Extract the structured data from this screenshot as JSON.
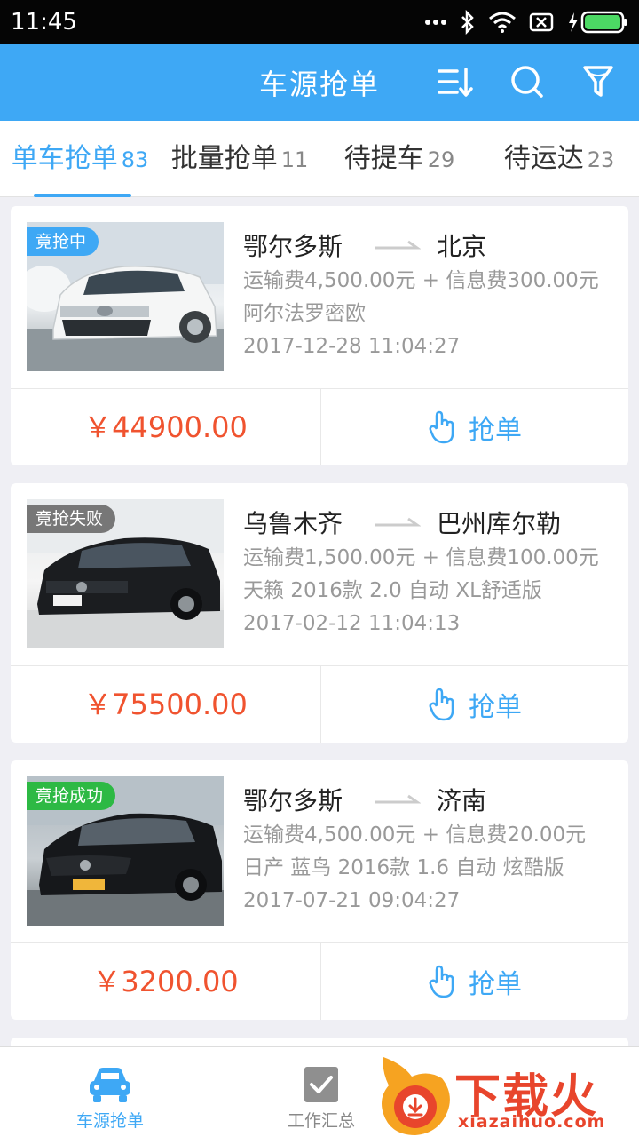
{
  "status_bar": {
    "time": "11:45"
  },
  "nav": {
    "title": "车源抢单"
  },
  "tabs": [
    {
      "label": "单车抢单",
      "count": "83"
    },
    {
      "label": "批量抢单",
      "count": "11"
    },
    {
      "label": "待提车",
      "count": "29"
    },
    {
      "label": "待运达",
      "count": "23"
    }
  ],
  "orders": [
    {
      "badge": "竟抢中",
      "from": "鄂尔多斯",
      "to": "北京",
      "fees": "运输费4,500.00元 + 信息费300.00元",
      "model": "阿尔法罗密欧",
      "date": "2017-12-28 11:04:27",
      "price": "￥44900.00",
      "action": "抢单"
    },
    {
      "badge": "竟抢失败",
      "from": "乌鲁木齐",
      "to": "巴州库尔勒",
      "fees": "运输费1,500.00元 + 信息费100.00元",
      "model": "天籁 2016款 2.0 自动 XL舒适版",
      "date": "2017-02-12 11:04:13",
      "price": "￥75500.00",
      "action": "抢单"
    },
    {
      "badge": "竟抢成功",
      "from": "鄂尔多斯",
      "to": "济南",
      "fees": "运输费4,500.00元 + 信息费20.00元",
      "model": "日产 蓝鸟 2016款 1.6 自动 炫酷版",
      "date": "2017-07-21 09:04:27",
      "price": "￥3200.00",
      "action": "抢单"
    }
  ],
  "tabbar": [
    {
      "label": "车源抢单"
    },
    {
      "label": "工作汇总"
    }
  ],
  "watermark": {
    "title": "下载火",
    "url": "xiazaihuo.com"
  },
  "colors": {
    "primary": "#3ea8f5",
    "price": "#f0532f",
    "badge_active": "#3ea8f5",
    "badge_failed": "#777777",
    "badge_success": "#2db944"
  }
}
